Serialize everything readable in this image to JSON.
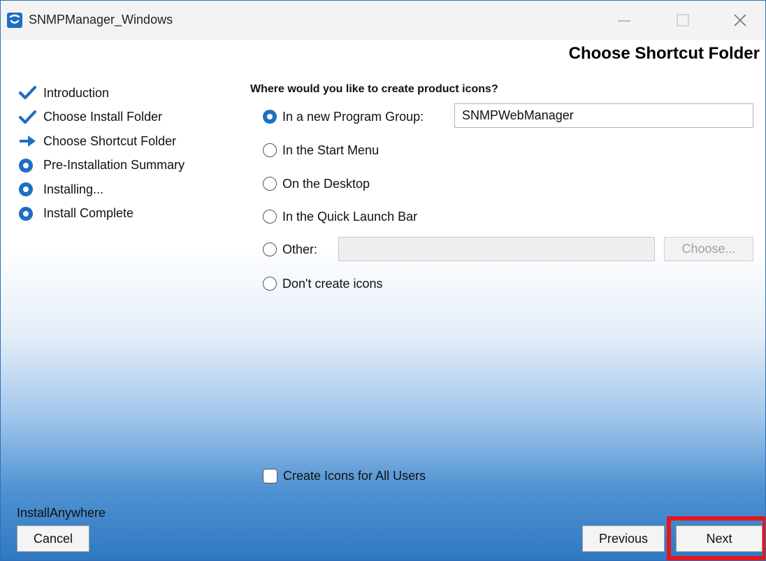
{
  "window": {
    "title": "SNMPManager_Windows"
  },
  "header": {
    "title": "Choose Shortcut Folder"
  },
  "steps": [
    {
      "label": "Introduction",
      "state": "done"
    },
    {
      "label": "Choose Install Folder",
      "state": "done"
    },
    {
      "label": "Choose Shortcut Folder",
      "state": "current"
    },
    {
      "label": "Pre-Installation Summary",
      "state": "pending"
    },
    {
      "label": "Installing...",
      "state": "pending"
    },
    {
      "label": "Install Complete",
      "state": "pending"
    }
  ],
  "main": {
    "question": "Where would you like to create product icons?",
    "options": [
      {
        "label": "In a new Program Group:",
        "selected": true
      },
      {
        "label": "In the Start Menu",
        "selected": false
      },
      {
        "label": "On the Desktop",
        "selected": false
      },
      {
        "label": "In the Quick Launch Bar",
        "selected": false
      },
      {
        "label": "Other:",
        "selected": false
      },
      {
        "label": "Don't create icons",
        "selected": false
      }
    ],
    "program_group_value": "SNMPWebManager",
    "other_value": "",
    "choose_label": "Choose...",
    "all_users_label": "Create Icons for All Users",
    "all_users_checked": false
  },
  "footer": {
    "brand": "InstallAnywhere",
    "cancel_label": "Cancel",
    "previous_label": "Previous",
    "next_label": "Next"
  },
  "colors": {
    "accent": "#1e6fc2",
    "highlight": "#e8141e",
    "gradient_bottom": "#2f78c0"
  }
}
